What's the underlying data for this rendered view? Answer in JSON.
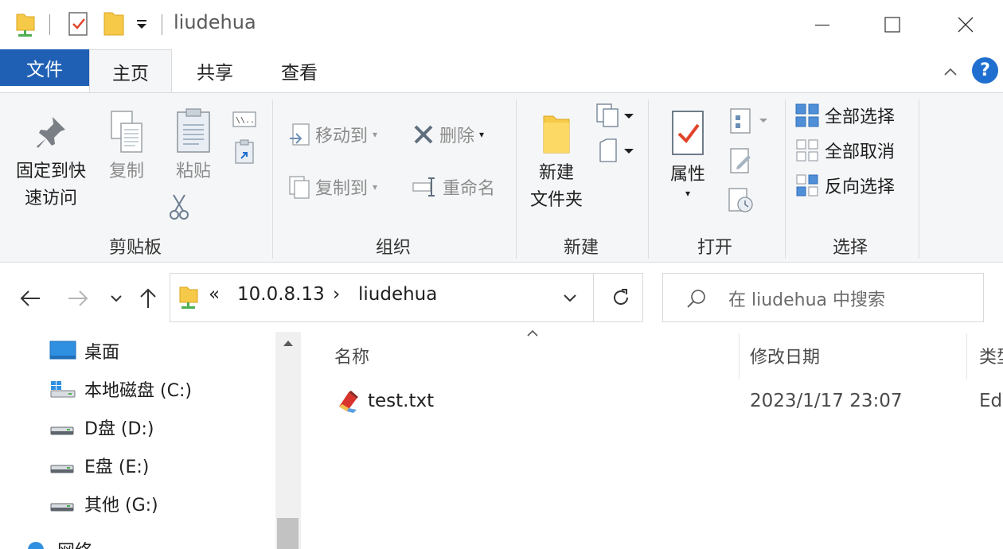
{
  "window": {
    "title": "liudehua"
  },
  "ribbon_tabs": {
    "file": "文件",
    "home": "主页",
    "share": "共享",
    "view": "查看",
    "help": "?"
  },
  "clipboard": {
    "pin_line1": "固定到快",
    "pin_line2": "速访问",
    "copy": "复制",
    "paste": "粘贴",
    "group": "剪贴板"
  },
  "organize": {
    "move_to": "移动到",
    "copy_to": "复制到",
    "delete": "删除",
    "rename": "重命名",
    "group": "组织"
  },
  "new_group": {
    "new_folder_line1": "新建",
    "new_folder_line2": "文件夹",
    "group": "新建"
  },
  "open_group": {
    "properties": "属性",
    "group": "打开"
  },
  "select_group": {
    "select_all": "全部选择",
    "select_none": "全部取消",
    "invert": "反向选择",
    "group": "选择"
  },
  "address": {
    "overflow": "«",
    "segments": [
      "10.0.8.13",
      "liudehua"
    ],
    "separator": "›"
  },
  "search": {
    "placeholder": "在 liudehua 中搜索"
  },
  "nav_pane": {
    "items": [
      {
        "label": "桌面",
        "icon": "desktop-icon"
      },
      {
        "label": "本地磁盘 (C:)",
        "icon": "system-drive-icon"
      },
      {
        "label": "D盘 (D:)",
        "icon": "drive-icon"
      },
      {
        "label": "E盘 (E:)",
        "icon": "drive-icon"
      },
      {
        "label": "其他 (G:)",
        "icon": "drive-icon"
      },
      {
        "label": "网络",
        "icon": "network-icon"
      }
    ]
  },
  "file_list": {
    "columns": {
      "name": "名称",
      "modified": "修改日期",
      "type": "类型"
    },
    "rows": [
      {
        "name": "test.txt",
        "modified": "2023/1/17 23:07",
        "type": "EditPlus"
      }
    ]
  },
  "colors": {
    "accent": "#1f5fb4",
    "ribbon_bg": "#f5f6f7",
    "folder": "#f7c948"
  }
}
